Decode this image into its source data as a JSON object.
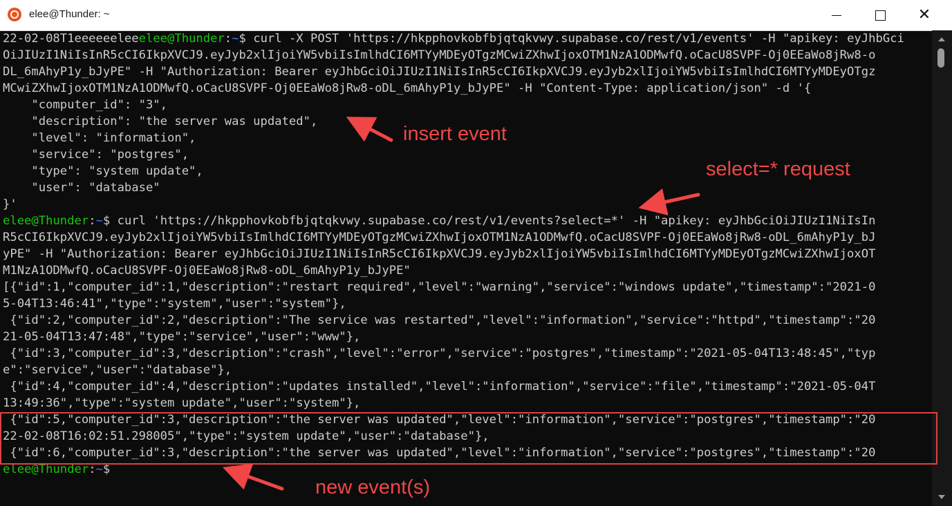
{
  "window": {
    "title": "elee@Thunder: ~",
    "minimize": "—",
    "close": "✕"
  },
  "terminal": {
    "cmd1_prefix": "22-02-08T1eeeeeelee",
    "user_host": "elee@Thunder",
    "colon": ":",
    "cwd": "~",
    "prompt_sym": "$",
    "cmd1_l1_rest": " curl -X POST 'https://hkpphovkobfbjqtqkvwy.supabase.co/rest/v1/events' -H \"apikey: eyJhbGci",
    "cmd1_l2": "OiJIUzI1NiIsInR5cCI6IkpXVCJ9.eyJyb2xlIjoiYW5vbiIsImlhdCI6MTYyMDEyOTgzMCwiZXhwIjoxOTM1NzA1ODMwfQ.oCacU8SVPF-Oj0EEaWo8jRw8-o",
    "cmd1_l3": "DL_6mAhyP1y_bJyPE\" -H \"Authorization: Bearer eyJhbGciOiJIUzI1NiIsInR5cCI6IkpXVCJ9.eyJyb2xlIjoiYW5vbiIsImlhdCI6MTYyMDEyOTgz",
    "cmd1_l4": "MCwiZXhwIjoxOTM1NzA1ODMwfQ.oCacU8SVPF-Oj0EEaWo8jRw8-oDL_6mAhyP1y_bJyPE\" -H \"Content-Type: application/json\" -d '{",
    "json_body": [
      "    \"computer_id\": \"3\",",
      "    \"description\": \"the server was updated\",",
      "    \"level\": \"information\",",
      "    \"service\": \"postgres\",",
      "    \"type\": \"system update\",",
      "    \"user\": \"database\"",
      "}'"
    ],
    "cmd2_l1_rest": " curl 'https://hkpphovkobfbjqtqkvwy.supabase.co/rest/v1/events?select=*' -H \"apikey: eyJhbGciOiJIUzI1NiIsIn",
    "cmd2_l2": "R5cCI6IkpXVCJ9.eyJyb2xlIjoiYW5vbiIsImlhdCI6MTYyMDEyOTgzMCwiZXhwIjoxOTM1NzA1ODMwfQ.oCacU8SVPF-Oj0EEaWo8jRw8-oDL_6mAhyP1y_bJ",
    "cmd2_l3": "yPE\" -H \"Authorization: Bearer eyJhbGciOiJIUzI1NiIsInR5cCI6IkpXVCJ9.eyJyb2xlIjoiYW5vbiIsImlhdCI6MTYyMDEyOTgzMCwiZXhwIjoxOT",
    "cmd2_l4": "M1NzA1ODMwfQ.oCacU8SVPF-Oj0EEaWo8jRw8-oDL_6mAhyP1y_bJyPE\"",
    "output": [
      "[{\"id\":1,\"computer_id\":1,\"description\":\"restart required\",\"level\":\"warning\",\"service\":\"windows update\",\"timestamp\":\"2021-0",
      "5-04T13:46:41\",\"type\":\"system\",\"user\":\"system\"},",
      " {\"id\":2,\"computer_id\":2,\"description\":\"The service was restarted\",\"level\":\"information\",\"service\":\"httpd\",\"timestamp\":\"20",
      "21-05-04T13:47:48\",\"type\":\"service\",\"user\":\"www\"},",
      " {\"id\":3,\"computer_id\":3,\"description\":\"crash\",\"level\":\"error\",\"service\":\"postgres\",\"timestamp\":\"2021-05-04T13:48:45\",\"typ",
      "e\":\"service\",\"user\":\"database\"},",
      " {\"id\":4,\"computer_id\":4,\"description\":\"updates installed\",\"level\":\"information\",\"service\":\"file\",\"timestamp\":\"2021-05-04T",
      "13:49:36\",\"type\":\"system update\",\"user\":\"system\"},",
      " {\"id\":5,\"computer_id\":3,\"description\":\"the server was updated\",\"level\":\"information\",\"service\":\"postgres\",\"timestamp\":\"20",
      "22-02-08T16:02:51.298005\",\"type\":\"system update\",\"user\":\"database\"},",
      " {\"id\":6,\"computer_id\":3,\"description\":\"the server was updated\",\"level\":\"information\",\"service\":\"postgres\",\"timestamp\":\"20"
    ]
  },
  "annotations": {
    "insert": "insert event",
    "select": "select=* request",
    "new": "new event(s)",
    "color": "#f04646"
  },
  "colors": {
    "background": "#0c0c0c",
    "text": "#cccccc",
    "prompt_user": "#16c60c",
    "prompt_path": "#3b78ff"
  }
}
